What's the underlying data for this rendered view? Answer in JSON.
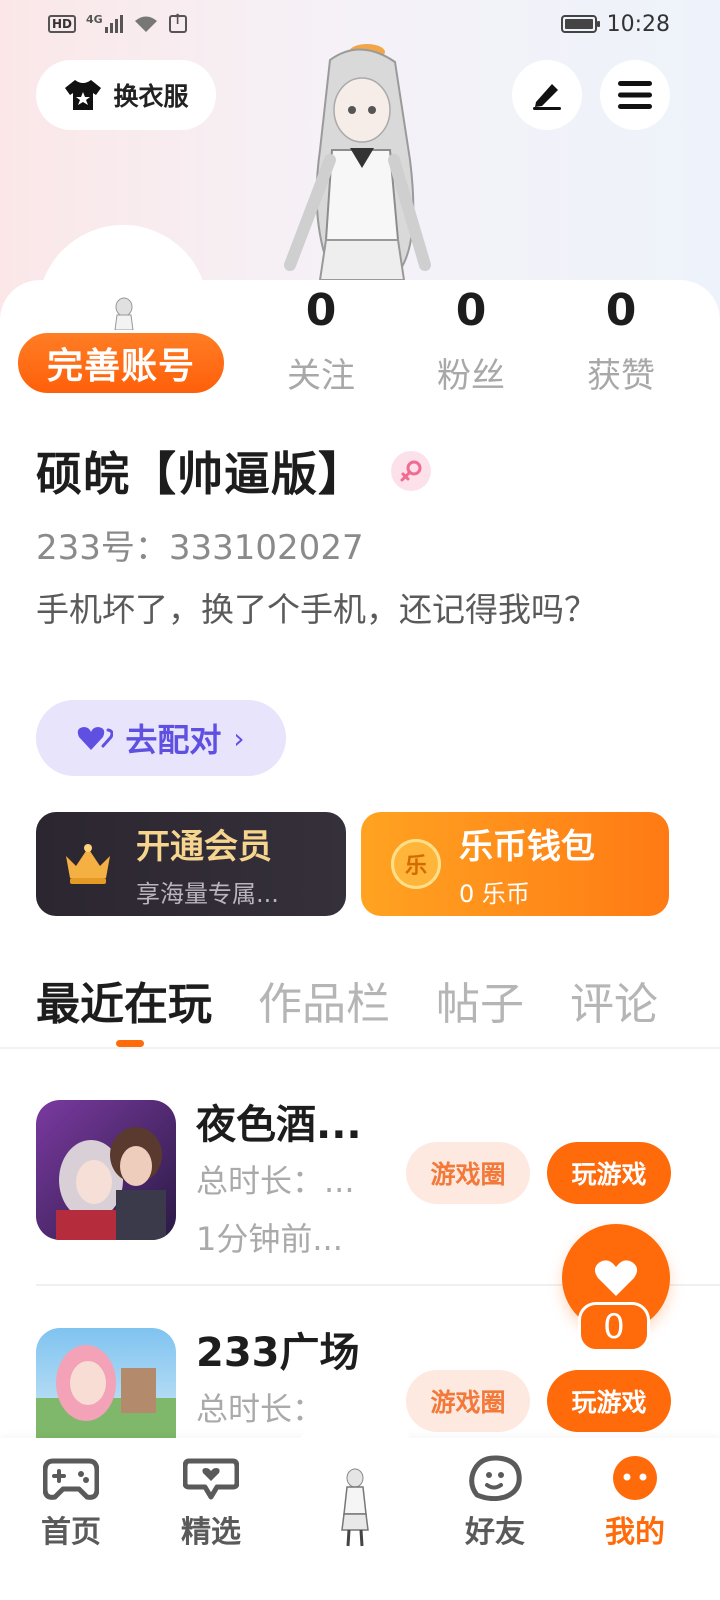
{
  "status_bar": {
    "network": "4G",
    "hd_badge": "HD",
    "time": "10:28"
  },
  "top_controls": {
    "outfit_label": "换衣服"
  },
  "profile": {
    "complete_account_label": "完善账号",
    "stats": [
      {
        "count": "0",
        "label": "关注"
      },
      {
        "count": "0",
        "label": "粉丝"
      },
      {
        "count": "0",
        "label": "获赞"
      }
    ],
    "username": "硕皖【帅逼版】",
    "user_id": "233号：333102027",
    "bio": "手机坏了，换了个手机，还记得我吗？",
    "match_label": "去配对"
  },
  "cards": {
    "member": {
      "title": "开通会员",
      "subtitle": "享海量专属..."
    },
    "wallet": {
      "title": "乐币钱包",
      "subtitle": "0 乐币",
      "coin_glyph": "乐"
    }
  },
  "tabs": [
    "最近在玩",
    "作品栏",
    "帖子",
    "评论"
  ],
  "games": [
    {
      "name": "夜色酒...",
      "duration": "总时长：...",
      "last_played": "1分钟前...",
      "circle_label": "游戏圈",
      "play_label": "玩游戏"
    },
    {
      "name": "233广场",
      "duration": "总时长：",
      "circle_label": "游戏圈",
      "play_label": "玩游戏"
    }
  ],
  "like_count": "0",
  "bottom_nav": [
    {
      "label": "首页",
      "icon": "gamepad-icon"
    },
    {
      "label": "精选",
      "icon": "heart-chat-icon"
    },
    {
      "label": "好友",
      "icon": "friend-face-icon"
    },
    {
      "label": "我的",
      "icon": "profile-face-icon",
      "active": true
    }
  ],
  "colors": {
    "accent": "#ff6a0a",
    "match_purple": "#5f50e2",
    "member_gold": "#f6d58f"
  }
}
